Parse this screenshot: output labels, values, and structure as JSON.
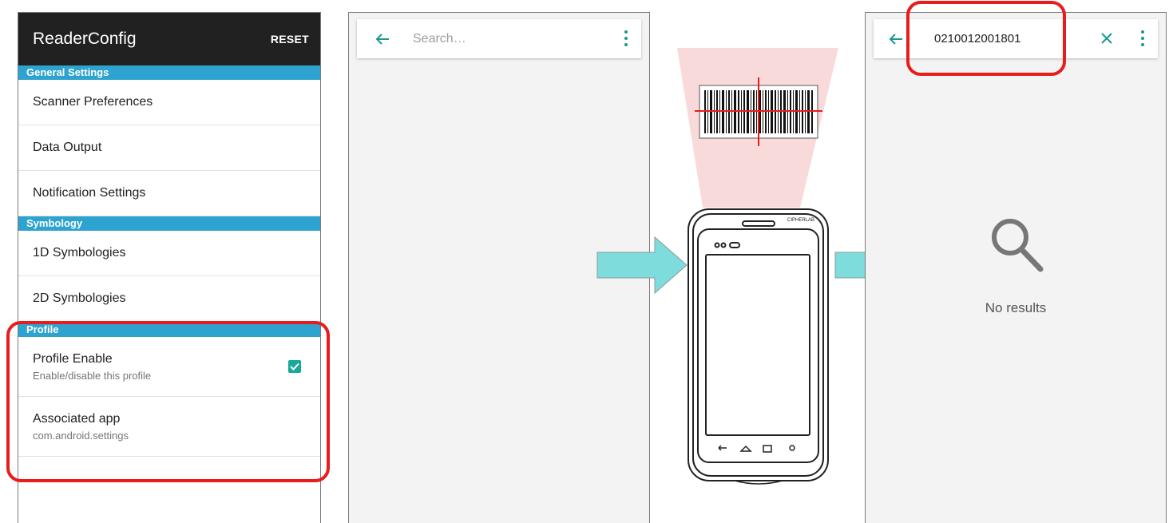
{
  "reader": {
    "title": "ReaderConfig",
    "reset_label": "RESET",
    "sections": {
      "general": "General Settings",
      "symbology": "Symbology",
      "profile": "Profile"
    },
    "items": {
      "scanner_preferences": "Scanner Preferences",
      "data_output": "Data Output",
      "notification_settings": "Notification Settings",
      "symbologies_1d": "1D Symbologies",
      "symbologies_2d": "2D Symbologies",
      "profile_enable": "Profile Enable",
      "profile_enable_sub": "Enable/disable this profile",
      "associated_app": "Associated app",
      "associated_app_sub": "com.android.settings"
    },
    "profile_enabled": true
  },
  "search_empty": {
    "placeholder": "Search…"
  },
  "device": {
    "brand": "CIPHERLAB"
  },
  "search_result": {
    "query": "0210012001801",
    "empty_text": "No results"
  },
  "colors": {
    "appbar": "#212121",
    "section": "#2ea3cf",
    "accent": "#1a9a8c",
    "highlight": "#e81c1c",
    "arrow": "#7fdcdc",
    "scan_beam": "#f9dada"
  }
}
